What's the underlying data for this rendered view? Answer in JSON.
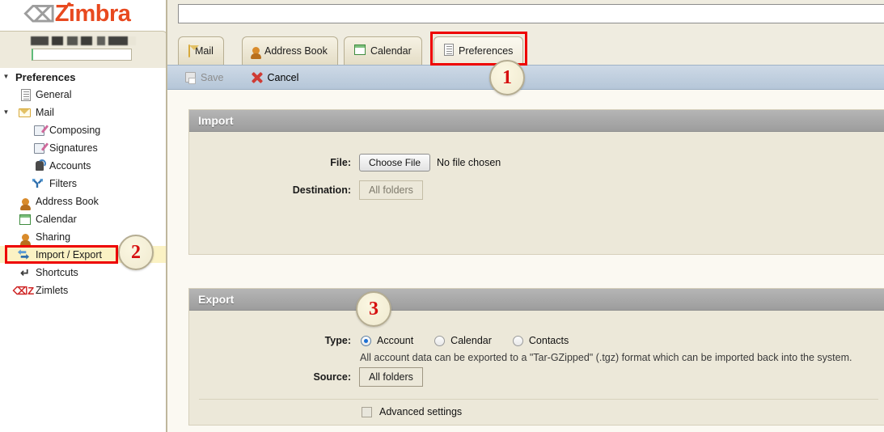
{
  "brand": {
    "name": "Zimbra",
    "logo_color": "#e8491f"
  },
  "account": {
    "name_redacted": true,
    "input_value": ""
  },
  "search": {
    "value": "",
    "placeholder": ""
  },
  "sidebar": {
    "header": {
      "label": "Preferences",
      "expanded": true
    },
    "items": [
      {
        "label": "General",
        "icon": "document-icon",
        "indent": 0,
        "twisty": ""
      },
      {
        "label": "Mail",
        "icon": "envelope-icon",
        "indent": 0,
        "twisty": "▼"
      },
      {
        "label": "Composing",
        "icon": "compose-icon",
        "indent": 1,
        "twisty": ""
      },
      {
        "label": "Signatures",
        "icon": "signature-icon",
        "indent": 1,
        "twisty": ""
      },
      {
        "label": "Accounts",
        "icon": "accounts-icon",
        "indent": 1,
        "twisty": ""
      },
      {
        "label": "Filters",
        "icon": "filter-icon",
        "indent": 1,
        "twisty": ""
      },
      {
        "label": "Address Book",
        "icon": "person-icon",
        "indent": 0,
        "twisty": ""
      },
      {
        "label": "Calendar",
        "icon": "calendar-icon",
        "indent": 0,
        "twisty": ""
      },
      {
        "label": "Sharing",
        "icon": "sharing-icon",
        "indent": 0,
        "twisty": ""
      },
      {
        "label": "Import / Export",
        "icon": "import-export-icon",
        "indent": 0,
        "twisty": "",
        "selected": true
      },
      {
        "label": "Shortcuts",
        "icon": "shortcut-icon",
        "indent": 0,
        "twisty": ""
      },
      {
        "label": "Zimlets",
        "icon": "zimlet-icon",
        "indent": 0,
        "twisty": ""
      }
    ]
  },
  "apptabs": [
    {
      "label": "Mail",
      "icon": "envelope-icon",
      "active": false
    },
    {
      "label": "Address Book",
      "icon": "person-icon",
      "active": false
    },
    {
      "label": "Calendar",
      "icon": "calendar-icon",
      "active": false
    },
    {
      "label": "Preferences",
      "icon": "preferences-icon",
      "active": true
    }
  ],
  "toolbar": {
    "save_label": "Save",
    "save_enabled": false,
    "cancel_label": "Cancel"
  },
  "import": {
    "title": "Import",
    "file_label": "File:",
    "choose_file_button": "Choose File",
    "file_status": "No file chosen",
    "destination_label": "Destination:",
    "destination_value": "All folders"
  },
  "export": {
    "title": "Export",
    "type_label": "Type:",
    "types": [
      {
        "label": "Account",
        "selected": true
      },
      {
        "label": "Calendar",
        "selected": false
      },
      {
        "label": "Contacts",
        "selected": false
      }
    ],
    "help_text": "All account data can be exported to a \"Tar-GZipped\" (.tgz) format which can be imported back into the system.",
    "source_label": "Source:",
    "source_value": "All folders",
    "advanced_settings_label": "Advanced settings",
    "advanced_settings_checked": false
  },
  "annotations": [
    {
      "number": "1",
      "target": "preferences-tab"
    },
    {
      "number": "2",
      "target": "import-export-sidebar-item"
    },
    {
      "number": "3",
      "target": "export-type-row"
    }
  ],
  "highlight_color": "#ee0000"
}
